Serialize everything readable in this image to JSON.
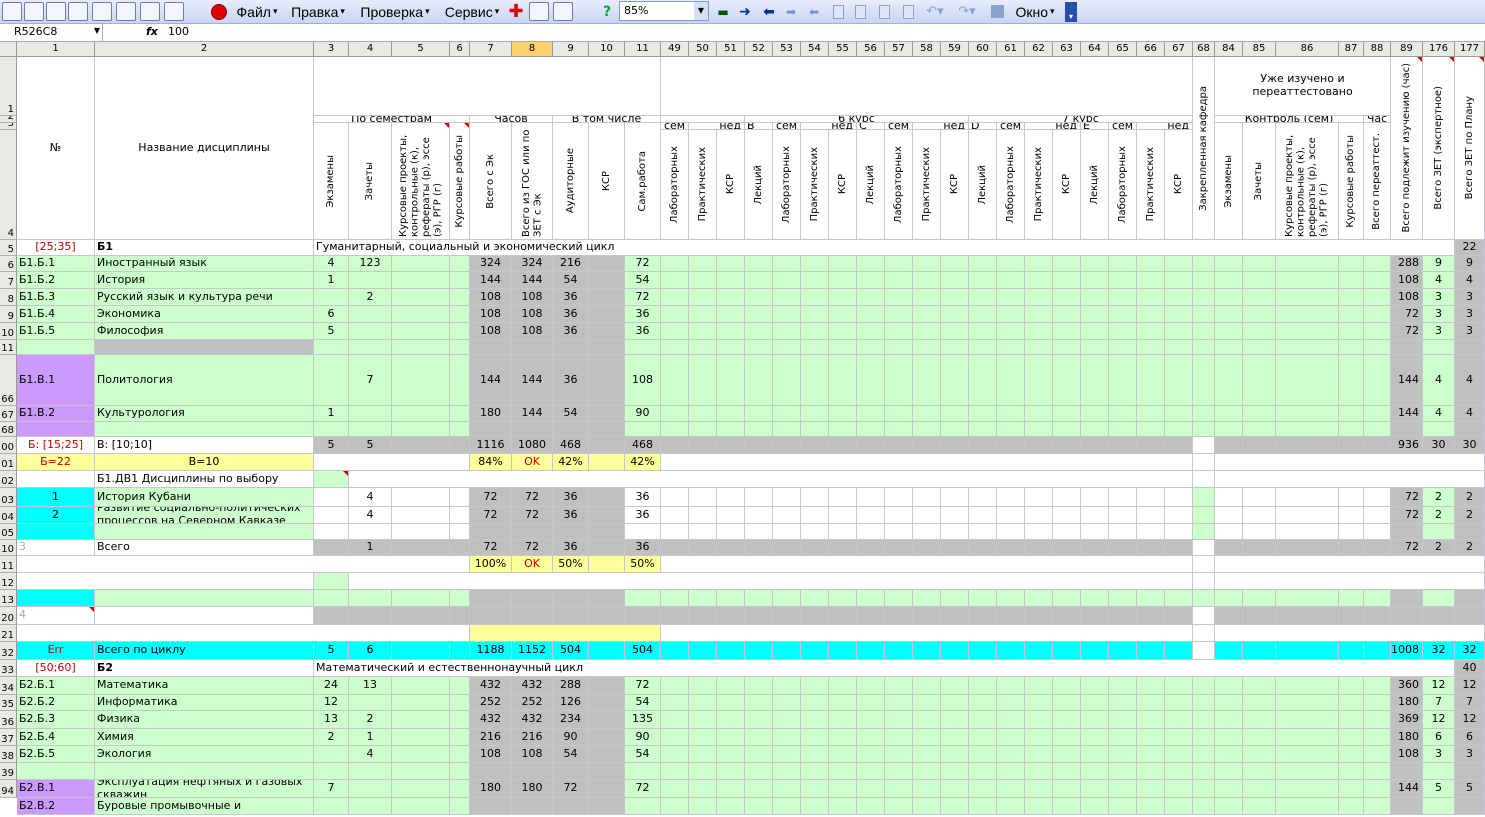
{
  "toolbar": {
    "menus": [
      "Файл",
      "Правка",
      "Проверка",
      "Сервис",
      "Окно"
    ],
    "zoom": "85%",
    "icons": [
      "plan-icon",
      "save-icon",
      "save-as-icon",
      "table-icon",
      "refresh-icon",
      "calc-icon",
      "chart-icon",
      "check-icon",
      "record-icon",
      "plus-icon",
      "grid-icon",
      "export-icon",
      "help-icon",
      "link-icon",
      "arrow-right-icon",
      "arrow-left-icon",
      "nav-icon",
      "nav2-icon",
      "page-icon",
      "table2-icon",
      "lock-icon",
      "undo-icon",
      "redo-icon",
      "option-icon"
    ]
  },
  "formula": {
    "cell": "R526C8",
    "fx": "fx",
    "value": "100"
  },
  "colnums": [
    "1",
    "2",
    "3",
    "4",
    "5",
    "6",
    "7",
    "8",
    "9",
    "10",
    "11",
    "49",
    "50",
    "51",
    "52",
    "53",
    "54",
    "55",
    "56",
    "57",
    "58",
    "59",
    "60",
    "61",
    "62",
    "63",
    "64",
    "65",
    "66",
    "67",
    "68",
    "84",
    "85",
    "86",
    "87",
    "88",
    "89",
    "176",
    "177"
  ],
  "rownums": [
    "1",
    "2",
    "3",
    "4",
    "5",
    "6",
    "7",
    "8",
    "9",
    "10",
    "11",
    "66",
    "67",
    "68",
    "00",
    "01",
    "02",
    "03",
    "04",
    "05",
    "10",
    "11",
    "12",
    "13",
    "20",
    "21",
    "32",
    "33",
    "34",
    "35",
    "36",
    "37",
    "38",
    "39",
    "94"
  ],
  "header": {
    "no": "№",
    "name": "Название дисциплины",
    "po_semestram": "По семестрам",
    "chasov": "Часов",
    "v_tom_chisle": "В том числе",
    "kurs6": "6 курс",
    "kurs7": "7 курс",
    "uzhe_izucheno": "Уже изучено и переаттестовано",
    "kontrol": "Контроль (сем)",
    "chas": "Час",
    "sem": "сем",
    "ned": "нед",
    "B": "В",
    "C": "С",
    "D": "D",
    "E": "E",
    "ekzameny": "Экзамены",
    "zachety": "Зачеты",
    "kursovye_proekty": "Курсовые проекты, контрольные (к), рефераты (р), эссе (э), РГР (г)",
    "kursovye_raboty": "Курсовые работы",
    "vsego_s_ek": "Всего с Эк",
    "vsego_iz_gos": "Всего из ГОС или по ЗЕТ с Эк",
    "auditornye": "Аудиторные",
    "ksr": "КСР",
    "sam_rabota": "Сам.работа",
    "laboratornyh": "Лабораторных",
    "prakticheskih": "Практических",
    "lekciy": "Лекций",
    "zakreplennaya": "Закрепленная кафедра",
    "vsego_pereattest": "Всего переаттест.",
    "vsego_podlezhit": "Всего подлежит изучению (час)",
    "vsego_zet_eksp": "Всего ЗЕТ (экспертное)",
    "vsego_zet_plan": "Всего ЗЕТ по Плану"
  },
  "rows": {
    "r5": {
      "id": "[25;35]",
      "name": "Б1",
      "desc": "Гуманитарный, социальный и экономический цикл",
      "p177": "22"
    },
    "r6": {
      "id": "Б1.Б.1",
      "name": "Иностранный язык",
      "c3": "4",
      "c4": "123",
      "c7": "324",
      "c8": "324",
      "c9": "216",
      "c11": "72",
      "c89": "288",
      "c176": "9",
      "c177": "9"
    },
    "r7": {
      "id": "Б1.Б.2",
      "name": "История",
      "c3": "1",
      "c4": "",
      "c7": "144",
      "c8": "144",
      "c9": "54",
      "c11": "54",
      "c89": "108",
      "c176": "4",
      "c177": "4"
    },
    "r8": {
      "id": "Б1.Б.3",
      "name": "Русский язык и культура речи",
      "c3": "",
      "c4": "2",
      "c7": "108",
      "c8": "108",
      "c9": "36",
      "c11": "72",
      "c89": "108",
      "c176": "3",
      "c177": "3"
    },
    "r9": {
      "id": "Б1.Б.4",
      "name": "Экономика",
      "c3": "6",
      "c4": "",
      "c7": "108",
      "c8": "108",
      "c9": "36",
      "c11": "36",
      "c89": "72",
      "c176": "3",
      "c177": "3"
    },
    "r10": {
      "id": "Б1.Б.5",
      "name": "Философия",
      "c3": "5",
      "c4": "",
      "c7": "108",
      "c8": "108",
      "c9": "36",
      "c11": "36",
      "c89": "72",
      "c176": "3",
      "c177": "3"
    },
    "r66": {
      "id": "Б1.В.1",
      "name": "Политология",
      "c3": "",
      "c4": "7",
      "c7": "144",
      "c8": "144",
      "c9": "36",
      "c11": "108",
      "c89": "144",
      "c176": "4",
      "c177": "4"
    },
    "r67": {
      "id": "Б1.В.2",
      "name": "Культурология",
      "c3": "1",
      "c4": "",
      "c7": "180",
      "c8": "144",
      "c9": "54",
      "c11": "90",
      "c89": "144",
      "c176": "4",
      "c177": "4"
    },
    "r00": {
      "id": "Б: [15;25]",
      "name": "В: [10;10]",
      "c3": "5",
      "c4": "5",
      "c7": "1116",
      "c8": "1080",
      "c9": "468",
      "c11": "468",
      "c89": "936",
      "c176": "30",
      "c177": "30"
    },
    "r01": {
      "id": "Б=22",
      "name": "В=10",
      "c7": "84%",
      "c8": "OK",
      "c9": "42%",
      "c11": "42%"
    },
    "r02": {
      "name": "Б1.ДВ1 Дисциплины по выбору"
    },
    "r03": {
      "id": "1",
      "name": "История Кубани",
      "c4": "4",
      "c7": "72",
      "c8": "72",
      "c9": "36",
      "c11": "36",
      "c89": "72",
      "c176": "2",
      "c177": "2"
    },
    "r04": {
      "id": "2",
      "name": "Развитие социально-политических процессов на Северном Кавказе",
      "c4": "4",
      "c7": "72",
      "c8": "72",
      "c9": "36",
      "c11": "36",
      "c89": "72",
      "c176": "2",
      "c177": "2"
    },
    "r10b": {
      "id": "3",
      "name": "Всего",
      "c4": "1",
      "c7": "72",
      "c8": "72",
      "c9": "36",
      "c11": "36",
      "c89": "72",
      "c176": "2",
      "c177": "2"
    },
    "r11b": {
      "c7": "100%",
      "c8": "OK",
      "c9": "50%",
      "c11": "50%"
    },
    "r20": {
      "id": "4"
    },
    "r32": {
      "id": "Err",
      "name": "Всего по циклу",
      "c3": "5",
      "c4": "6",
      "c7": "1188",
      "c8": "1152",
      "c9": "504",
      "c11": "504",
      "c89": "1008",
      "c176": "32",
      "c177": "32"
    },
    "r33": {
      "id": "[50;60]",
      "name": "Б2",
      "desc": "Математический и естественнонаучный цикл",
      "c177": "40"
    },
    "r34": {
      "id": "Б2.Б.1",
      "name": "Математика",
      "c3": "24",
      "c4": "13",
      "c7": "432",
      "c8": "432",
      "c9": "288",
      "c11": "72",
      "c89": "360",
      "c176": "12",
      "c177": "12"
    },
    "r35": {
      "id": "Б2.Б.2",
      "name": "Информатика",
      "c3": "12",
      "c4": "",
      "c7": "252",
      "c8": "252",
      "c9": "126",
      "c11": "54",
      "c89": "180",
      "c176": "7",
      "c177": "7"
    },
    "r36": {
      "id": "Б2.Б.3",
      "name": "Физика",
      "c3": "13",
      "c4": "2",
      "c7": "432",
      "c8": "432",
      "c9": "234",
      "c11": "135",
      "c89": "369",
      "c176": "12",
      "c177": "12"
    },
    "r37": {
      "id": "Б2.Б.4",
      "name": "Химия",
      "c3": "2",
      "c4": "1",
      "c7": "216",
      "c8": "216",
      "c9": "90",
      "c11": "90",
      "c89": "180",
      "c176": "6",
      "c177": "6"
    },
    "r38": {
      "id": "Б2.Б.5",
      "name": "Экология",
      "c3": "",
      "c4": "4",
      "c7": "108",
      "c8": "108",
      "c9": "54",
      "c11": "54",
      "c89": "108",
      "c176": "3",
      "c177": "3"
    },
    "r94": {
      "id": "Б2.В.1",
      "name": "Эксплуатация нефтяных и газовых скважин",
      "c3": "7",
      "c4": "",
      "c7": "180",
      "c8": "180",
      "c9": "72",
      "c11": "72",
      "c89": "144",
      "c176": "5",
      "c177": "5"
    },
    "r95": {
      "id": "Б2.В.2",
      "name": "Буровые промывочные и"
    }
  }
}
